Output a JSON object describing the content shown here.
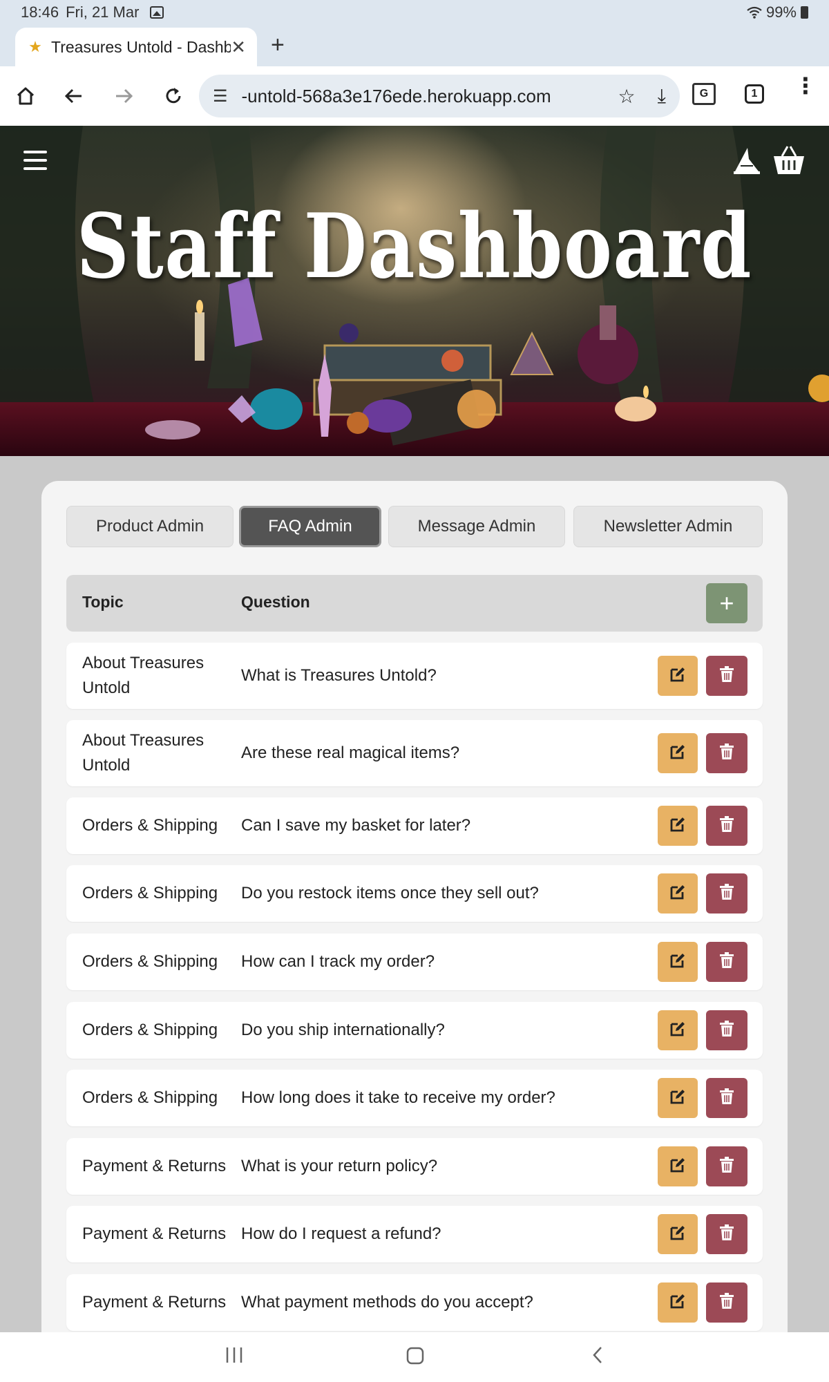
{
  "status_bar": {
    "time": "18:46",
    "date": "Fri, 21 Mar",
    "battery": "99%"
  },
  "browser": {
    "tab_title": "Treasures Untold - Dashb",
    "url": "-untold-568a3e176ede.herokuapp.com",
    "tab_count": "1"
  },
  "hero": {
    "title": "Staff Dashboard"
  },
  "admin_tabs": [
    {
      "label": "Product Admin",
      "active": false
    },
    {
      "label": "FAQ Admin",
      "active": true
    },
    {
      "label": "Message Admin",
      "active": false
    },
    {
      "label": "Newsletter Admin",
      "active": false
    }
  ],
  "faq_table": {
    "headers": {
      "topic": "Topic",
      "question": "Question"
    },
    "add_label": "+",
    "rows": [
      {
        "topic": "About Treasures Untold",
        "question": "What is Treasures Untold?"
      },
      {
        "topic": "About Treasures Untold",
        "question": "Are these real magical items?"
      },
      {
        "topic": "Orders & Shipping",
        "question": "Can I save my basket for later?"
      },
      {
        "topic": "Orders & Shipping",
        "question": "Do you restock items once they sell out?"
      },
      {
        "topic": "Orders & Shipping",
        "question": "How can I track my order?"
      },
      {
        "topic": "Orders & Shipping",
        "question": "Do you ship internationally?"
      },
      {
        "topic": "Orders & Shipping",
        "question": "How long does it take to receive my order?"
      },
      {
        "topic": "Payment & Returns",
        "question": "What is your return policy?"
      },
      {
        "topic": "Payment & Returns",
        "question": "How do I request a refund?"
      },
      {
        "topic": "Payment & Returns",
        "question": "What payment methods do you accept?"
      }
    ]
  },
  "colors": {
    "edit_button": "#e8b264",
    "delete_button": "#9c4a56",
    "add_button": "#7d9474",
    "active_tab": "#545454"
  }
}
